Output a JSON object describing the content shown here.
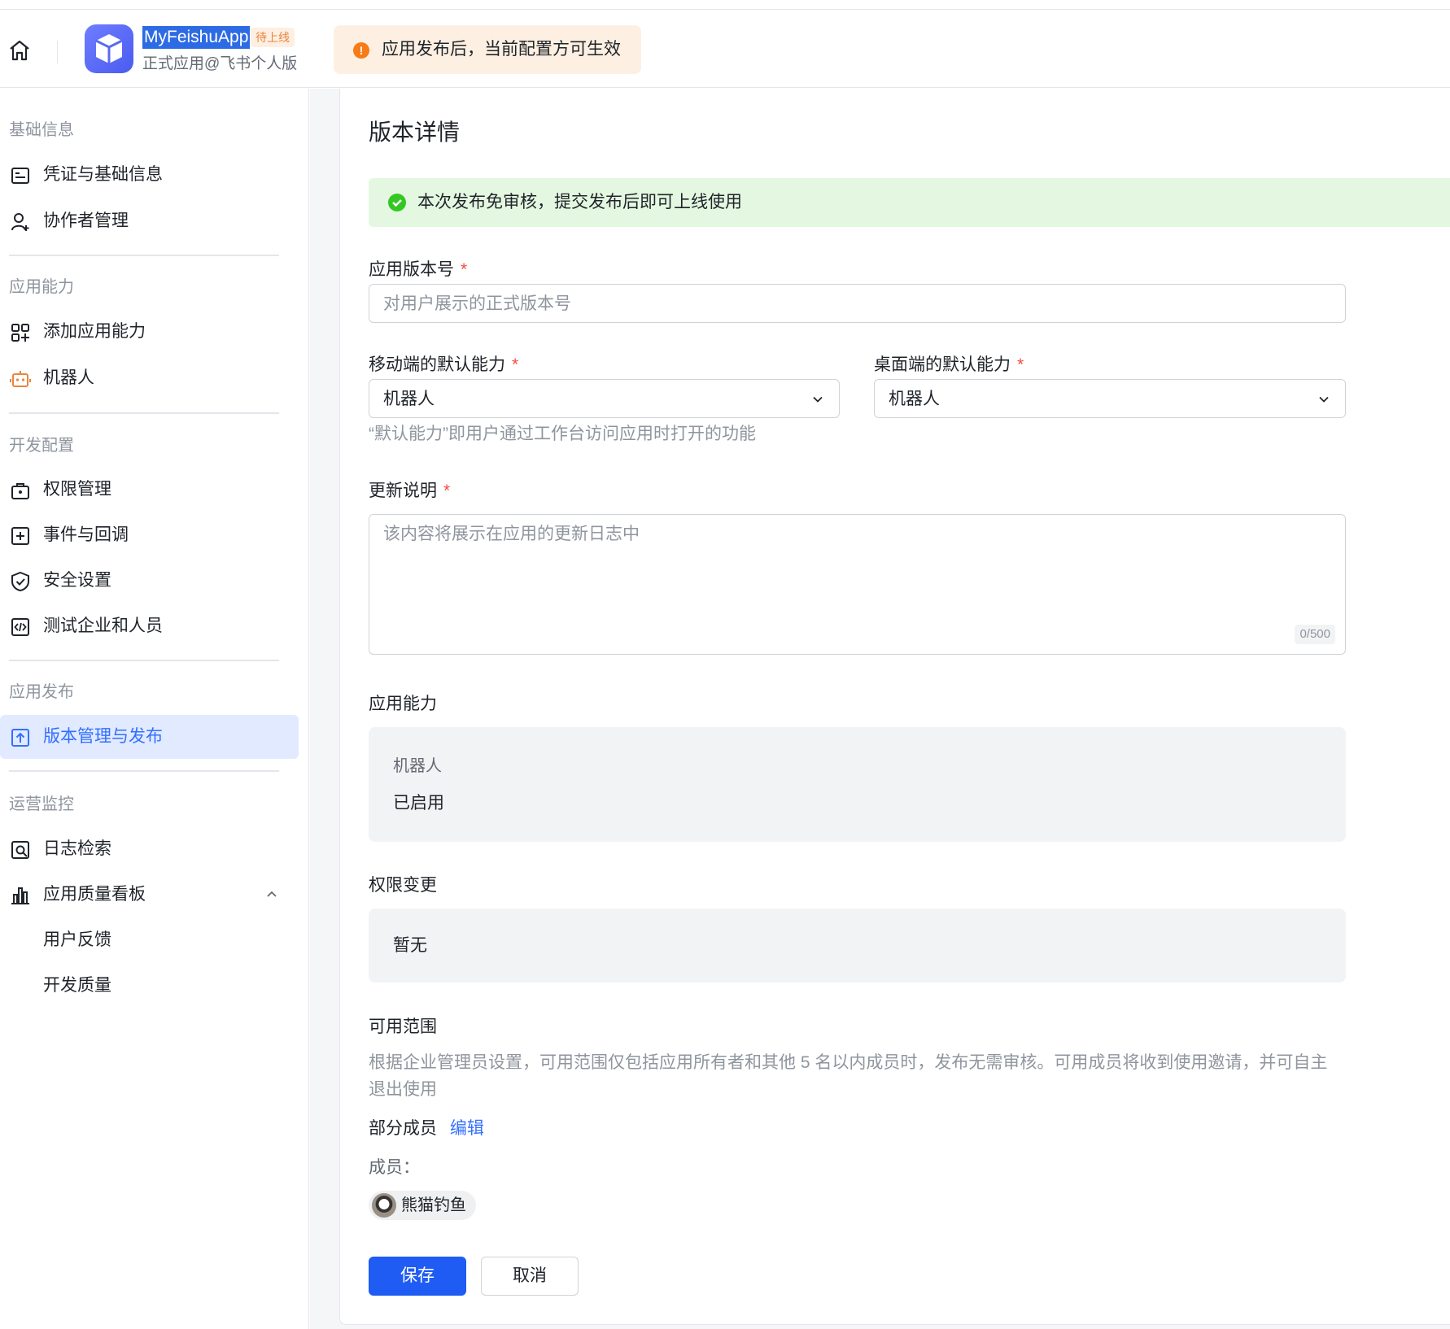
{
  "header": {
    "app_name": "MyFeishuApp",
    "app_status_badge": "待上线",
    "app_subtitle": "正式应用@飞书个人版",
    "notice": "应用发布后，当前配置方可生效"
  },
  "sidebar": {
    "groups": [
      {
        "title": "基础信息",
        "items": [
          {
            "label": "凭证与基础信息",
            "icon": "credential-icon"
          },
          {
            "label": "协作者管理",
            "icon": "user-add-icon"
          }
        ]
      },
      {
        "title": "应用能力",
        "items": [
          {
            "label": "添加应用能力",
            "icon": "apps-add-icon"
          },
          {
            "label": "机器人",
            "icon": "robot-icon"
          }
        ]
      },
      {
        "title": "开发配置",
        "items": [
          {
            "label": "权限管理",
            "icon": "permission-icon"
          },
          {
            "label": "事件与回调",
            "icon": "event-icon"
          },
          {
            "label": "安全设置",
            "icon": "shield-icon"
          },
          {
            "label": "测试企业和人员",
            "icon": "code-icon"
          }
        ]
      },
      {
        "title": "应用发布",
        "items": [
          {
            "label": "版本管理与发布",
            "icon": "upload-icon",
            "active": true
          }
        ]
      },
      {
        "title": "运营监控",
        "items": [
          {
            "label": "日志检索",
            "icon": "log-search-icon"
          },
          {
            "label": "应用质量看板",
            "icon": "bar-chart-icon",
            "expanded": true,
            "children": [
              {
                "label": "用户反馈"
              },
              {
                "label": "开发质量"
              }
            ]
          }
        ]
      }
    ]
  },
  "main": {
    "title": "版本详情",
    "success_notice": "本次发布免审核，提交发布后即可上线使用",
    "version": {
      "label": "应用版本号",
      "required_mark": "*",
      "placeholder": "对用户展示的正式版本号",
      "value": ""
    },
    "mobile_default": {
      "label": "移动端的默认能力",
      "required_mark": "*",
      "value": "机器人"
    },
    "desktop_default": {
      "label": "桌面端的默认能力",
      "required_mark": "*",
      "value": "机器人"
    },
    "default_hint": "“默认能力”即用户通过工作台访问应用时打开的功能",
    "release_notes": {
      "label": "更新说明",
      "required_mark": "*",
      "placeholder": "该内容将展示在应用的更新日志中",
      "counter": "0/500"
    },
    "capabilities": {
      "label": "应用能力",
      "name": "机器人",
      "status": "已启用"
    },
    "permission_changes": {
      "label": "权限变更",
      "value": "暂无"
    },
    "scope": {
      "label": "可用范围",
      "desc_line1": "根据企业管理员设置，可用范围仅包括应用所有者和其他 5 名以内成员时，发布无需审核。可用成员将收到使用邀请，并可自主",
      "desc_line2": "退出使用",
      "partial": "部分成员",
      "edit": "编辑",
      "members_label": "成员：",
      "members": [
        "熊猫钓鱼"
      ]
    },
    "buttons": {
      "save": "保存",
      "cancel": "取消"
    }
  },
  "colors": {
    "primary": "#1f5cf3",
    "active_bg": "#e1eaff",
    "success_bg": "#e4f8e1",
    "warning_bg": "#fdf0e2",
    "required": "#f54a45"
  }
}
